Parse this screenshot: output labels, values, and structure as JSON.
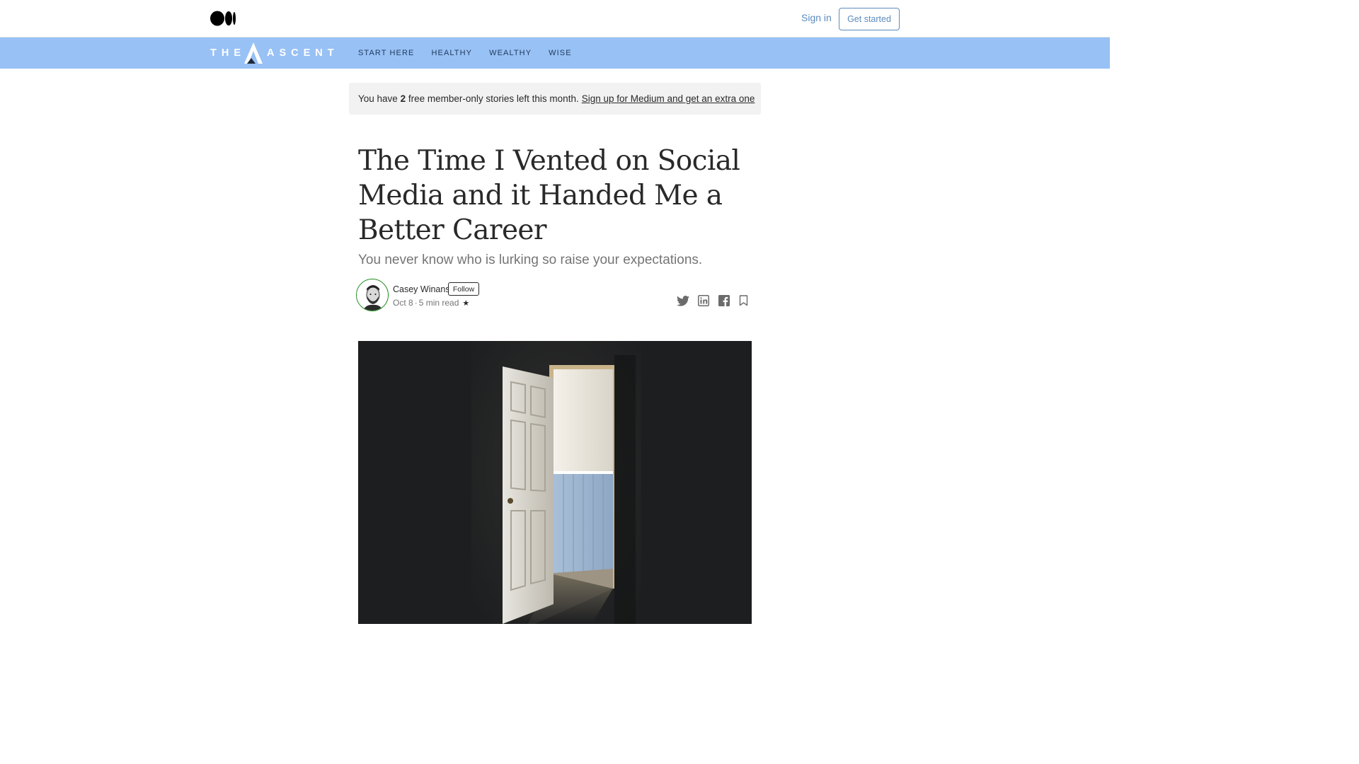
{
  "topbar": {
    "logo_icon": "medium-logo-icon",
    "sign_in": "Sign in",
    "get_started": "Get started"
  },
  "publication": {
    "logo_left": "THE",
    "logo_right": "ASCENT",
    "nav": [
      "START HERE",
      "HEALTHY",
      "WEALTHY",
      "WISE"
    ],
    "bar_color": "#98c1f5"
  },
  "banner": {
    "prefix": "You have",
    "count": "2",
    "suffix": "free member-only stories left this month.",
    "link": "Sign up for Medium and get an extra one"
  },
  "article": {
    "title": "The Time I Vented on Social Media and it Handed Me a Better Career",
    "subtitle": "You never know who is lurking so raise your expectations.",
    "author": "Casey Winans",
    "follow": "Follow",
    "date": "Oct 8",
    "separator": "·",
    "read_time": "5 min read",
    "member_star": "★",
    "share_icons": [
      "twitter-icon",
      "linkedin-icon",
      "facebook-icon",
      "bookmark-icon"
    ],
    "hero_image": "open-door-into-lit-room"
  },
  "colors": {
    "accent": "#5d8bbd",
    "follow_ring": "#1a8917"
  }
}
